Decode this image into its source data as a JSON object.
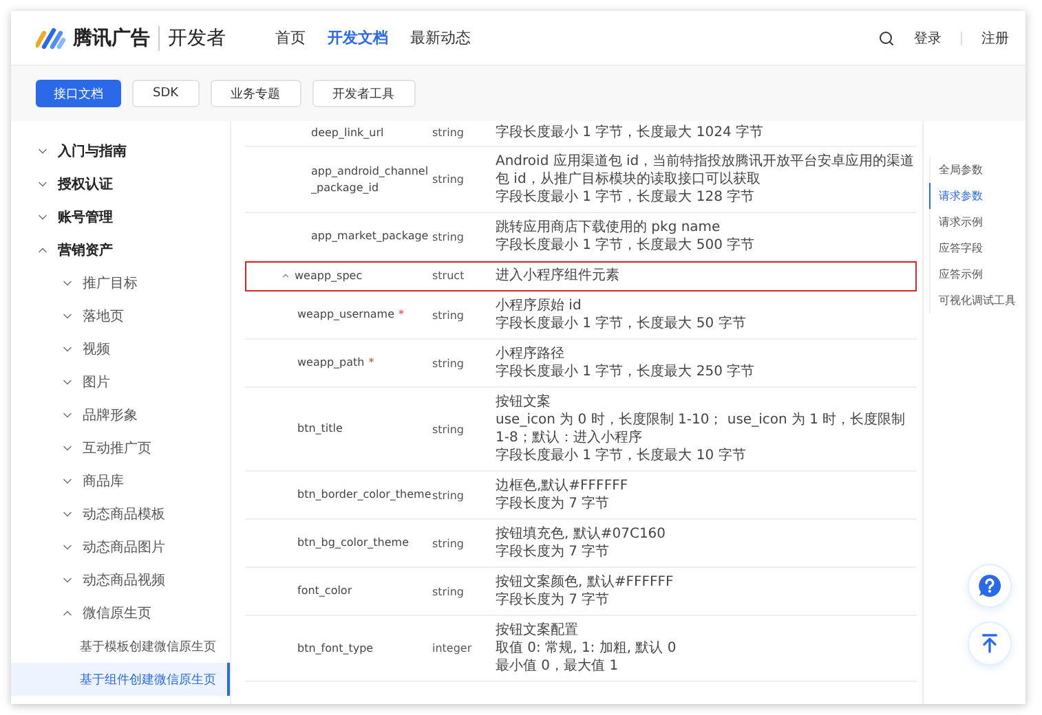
{
  "header": {
    "brand": "腾讯广告",
    "product": "开发者",
    "nav": [
      {
        "label": "首页",
        "selected": false
      },
      {
        "label": "开发文档",
        "selected": true
      },
      {
        "label": "最新动态",
        "selected": false
      }
    ],
    "actions": [
      "登录",
      "注册"
    ]
  },
  "subnav": [
    {
      "label": "接口文档",
      "selected": true
    },
    {
      "label": "SDK",
      "selected": false
    },
    {
      "label": "业务专题",
      "selected": false
    },
    {
      "label": "开发者工具",
      "selected": false
    }
  ],
  "sidebar": {
    "items": [
      {
        "label": "入门与指南",
        "expanded": false
      },
      {
        "label": "授权认证",
        "expanded": false
      },
      {
        "label": "账号管理",
        "expanded": false
      },
      {
        "label": "营销资产",
        "expanded": true,
        "children": [
          {
            "label": "推广目标",
            "expanded": false
          },
          {
            "label": "落地页",
            "expanded": false
          },
          {
            "label": "视频",
            "expanded": false
          },
          {
            "label": "图片",
            "expanded": false
          },
          {
            "label": "品牌形象",
            "expanded": false
          },
          {
            "label": "互动推广页",
            "expanded": false
          },
          {
            "label": "商品库",
            "expanded": false
          },
          {
            "label": "动态商品模板",
            "expanded": false
          },
          {
            "label": "动态商品图片",
            "expanded": false
          },
          {
            "label": "动态商品视频",
            "expanded": false
          },
          {
            "label": "微信原生页",
            "expanded": true,
            "children": [
              {
                "label": "基于模板创建微信原生页",
                "selected": false
              },
              {
                "label": "基于组件创建微信原生页",
                "selected": true
              }
            ]
          }
        ]
      }
    ]
  },
  "table": {
    "rows": [
      {
        "name": "deep_link_url",
        "type": "string",
        "description": [
          "字段长度最小 1 字节，长度最大 1024 字节"
        ]
      },
      {
        "name": "app_android_channel_package_id",
        "type": "string",
        "description": [
          "Android 应用渠道包 id，当前特指投放腾讯开放平台安卓应用的渠道包 id，从推广目标模块的读取接口可以获取",
          "字段长度最小 1 字节，长度最大 128 字节"
        ]
      },
      {
        "name": "app_market_package",
        "type": "string",
        "description": [
          "跳转应用商店下载使用的 pkg name",
          "字段长度最小 1 字节，长度最大 500 字节"
        ]
      },
      {
        "name": "weapp_spec",
        "type": "struct",
        "description": [
          "进入小程序组件元素"
        ],
        "expanded": true,
        "highlighted": true,
        "children": [
          {
            "name": "weapp_username",
            "marker": "*",
            "type": "string",
            "description": [
              "小程序原始 id",
              "字段长度最小 1 字节，长度最大 50 字节"
            ]
          },
          {
            "name": "weapp_path",
            "marker": "*",
            "type": "string",
            "description": [
              "小程序路径",
              "字段长度最小 1 字节，长度最大 250 字节"
            ]
          },
          {
            "name": "btn_title",
            "type": "string",
            "description": [
              "按钮文案",
              "use_icon 为 0 时，长度限制 1-10； use_icon 为 1 时，长度限制 1-8；默认：进入小程序",
              "字段长度最小 1 字节，长度最大 10 字节"
            ]
          },
          {
            "name": "btn_border_color_theme",
            "type": "string",
            "description": [
              "边框色,默认#FFFFFF",
              "字段长度为 7 字节"
            ]
          },
          {
            "name": "btn_bg_color_theme",
            "type": "string",
            "description": [
              "按钮填充色, 默认#07C160",
              "字段长度为 7 字节"
            ]
          },
          {
            "name": "font_color",
            "type": "string",
            "description": [
              "按钮文案颜色, 默认#FFFFFF",
              "字段长度为 7 字节"
            ]
          },
          {
            "name": "btn_font_type",
            "type": "integer",
            "description": [
              "按钮文案配置",
              "取值 0: 常规, 1: 加粗, 默认 0",
              "最小值 0，最大值 1"
            ]
          }
        ]
      }
    ]
  },
  "toc": [
    {
      "label": "全局参数",
      "selected": false
    },
    {
      "label": "请求参数",
      "selected": true
    },
    {
      "label": "请求示例",
      "selected": false
    },
    {
      "label": "应答字段",
      "selected": false
    },
    {
      "label": "应答示例",
      "selected": false
    },
    {
      "label": "可视化调试工具",
      "selected": false
    }
  ]
}
